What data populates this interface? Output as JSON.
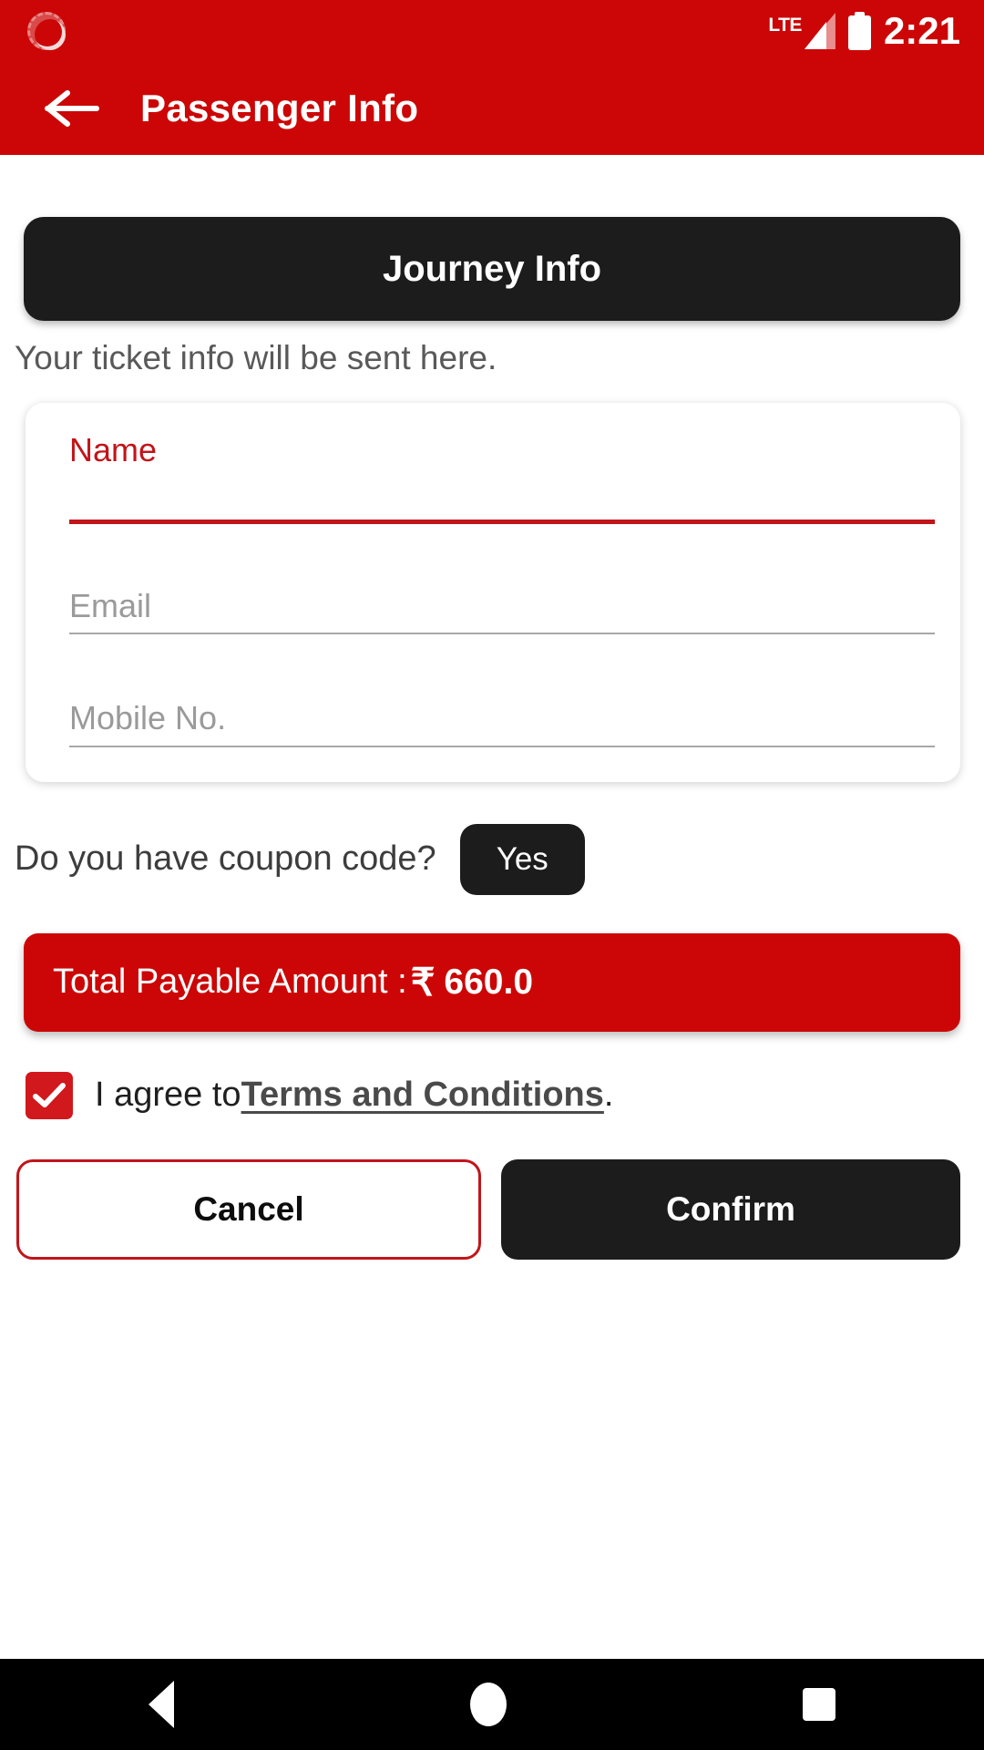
{
  "statusbar": {
    "notification_icon": "sun-notification-icon",
    "network_label": "LTE",
    "signal_icon": "signal-bars-icon",
    "battery_icon": "battery-full-icon",
    "time": "2:21"
  },
  "appbar": {
    "back_icon": "back-arrow-icon",
    "title": "Passenger Info"
  },
  "journey": {
    "button_label": "Journey Info"
  },
  "subtitle": "Your ticket info will be sent here.",
  "form": {
    "name": {
      "label": "Name",
      "value": "",
      "placeholder": "Name"
    },
    "email": {
      "label": "Email",
      "value": "",
      "placeholder": "Email"
    },
    "mobile": {
      "label": "Mobile No.",
      "value": "",
      "placeholder": "Mobile No."
    }
  },
  "coupon": {
    "question": "Do you have coupon code?",
    "yes_label": "Yes"
  },
  "total": {
    "label": "Total Payable Amount :",
    "currency": "₹",
    "amount": "660.0"
  },
  "agreement": {
    "checked": true,
    "prefix": "I agree to ",
    "link_text": "Terms and Conditions",
    "suffix": "."
  },
  "actions": {
    "cancel_label": "Cancel",
    "confirm_label": "Confirm"
  },
  "navbar": {
    "back_icon": "nav-back-icon",
    "home_icon": "nav-home-icon",
    "recent_icon": "nav-recents-icon"
  },
  "colors": {
    "brand_red": "#cc0606",
    "dark": "#1c1c1c",
    "accent_red": "#c1151a",
    "checkbox_red": "#d1181c"
  }
}
